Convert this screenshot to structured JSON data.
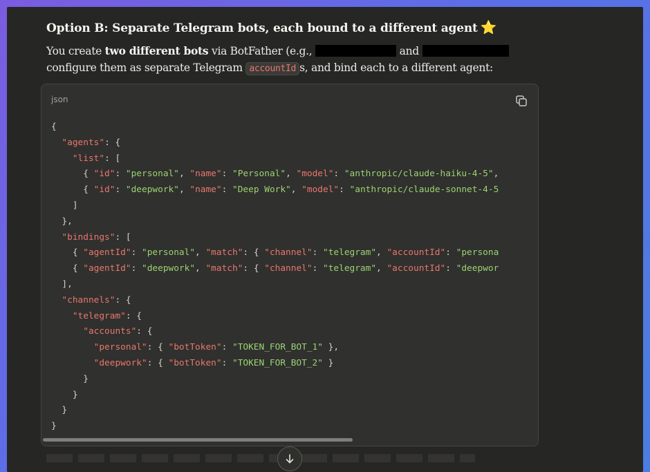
{
  "heading": {
    "title": "Option B: Separate Telegram bots, each bound to a different agent",
    "emoji": "⭐"
  },
  "paragraph": {
    "part1": "You create ",
    "bold": "two different bots",
    "part2": " via BotFather (e.g., ",
    "part3": " and ",
    "line2_start": "configure them as separate Telegram ",
    "inline_code": "accountId",
    "part4": "s, and bind each to a different agent:"
  },
  "code_block": {
    "language": "json",
    "copy_icon": "copy-icon",
    "lines": [
      [
        [
          "p",
          "{"
        ]
      ],
      [
        [
          "p",
          "  "
        ],
        [
          "k",
          "\"agents\""
        ],
        [
          "p",
          ": {"
        ]
      ],
      [
        [
          "p",
          "    "
        ],
        [
          "k",
          "\"list\""
        ],
        [
          "p",
          ": ["
        ]
      ],
      [
        [
          "p",
          "      { "
        ],
        [
          "k",
          "\"id\""
        ],
        [
          "p",
          ": "
        ],
        [
          "s",
          "\"personal\""
        ],
        [
          "p",
          ", "
        ],
        [
          "k",
          "\"name\""
        ],
        [
          "p",
          ": "
        ],
        [
          "s",
          "\"Personal\""
        ],
        [
          "p",
          ", "
        ],
        [
          "k",
          "\"model\""
        ],
        [
          "p",
          ": "
        ],
        [
          "s",
          "\"anthropic/claude-haiku-4-5\""
        ],
        [
          "p",
          ","
        ]
      ],
      [
        [
          "p",
          "      { "
        ],
        [
          "k",
          "\"id\""
        ],
        [
          "p",
          ": "
        ],
        [
          "s",
          "\"deepwork\""
        ],
        [
          "p",
          ", "
        ],
        [
          "k",
          "\"name\""
        ],
        [
          "p",
          ": "
        ],
        [
          "s",
          "\"Deep Work\""
        ],
        [
          "p",
          ", "
        ],
        [
          "k",
          "\"model\""
        ],
        [
          "p",
          ": "
        ],
        [
          "s",
          "\"anthropic/claude-sonnet-4-5"
        ]
      ],
      [
        [
          "p",
          "    ]"
        ]
      ],
      [
        [
          "p",
          "  },"
        ]
      ],
      [
        [
          "p",
          "  "
        ],
        [
          "k",
          "\"bindings\""
        ],
        [
          "p",
          ": ["
        ]
      ],
      [
        [
          "p",
          "    { "
        ],
        [
          "k",
          "\"agentId\""
        ],
        [
          "p",
          ": "
        ],
        [
          "s",
          "\"personal\""
        ],
        [
          "p",
          ", "
        ],
        [
          "k",
          "\"match\""
        ],
        [
          "p",
          ": { "
        ],
        [
          "k",
          "\"channel\""
        ],
        [
          "p",
          ": "
        ],
        [
          "s",
          "\"telegram\""
        ],
        [
          "p",
          ", "
        ],
        [
          "k",
          "\"accountId\""
        ],
        [
          "p",
          ": "
        ],
        [
          "s",
          "\"persona"
        ]
      ],
      [
        [
          "p",
          "    { "
        ],
        [
          "k",
          "\"agentId\""
        ],
        [
          "p",
          ": "
        ],
        [
          "s",
          "\"deepwork\""
        ],
        [
          "p",
          ", "
        ],
        [
          "k",
          "\"match\""
        ],
        [
          "p",
          ": { "
        ],
        [
          "k",
          "\"channel\""
        ],
        [
          "p",
          ": "
        ],
        [
          "s",
          "\"telegram\""
        ],
        [
          "p",
          ", "
        ],
        [
          "k",
          "\"accountId\""
        ],
        [
          "p",
          ": "
        ],
        [
          "s",
          "\"deepwor"
        ]
      ],
      [
        [
          "p",
          "  ],"
        ]
      ],
      [
        [
          "p",
          "  "
        ],
        [
          "k",
          "\"channels\""
        ],
        [
          "p",
          ": {"
        ]
      ],
      [
        [
          "p",
          "    "
        ],
        [
          "k",
          "\"telegram\""
        ],
        [
          "p",
          ": {"
        ]
      ],
      [
        [
          "p",
          "      "
        ],
        [
          "k",
          "\"accounts\""
        ],
        [
          "p",
          ": {"
        ]
      ],
      [
        [
          "p",
          "        "
        ],
        [
          "k",
          "\"personal\""
        ],
        [
          "p",
          ": { "
        ],
        [
          "k",
          "\"botToken\""
        ],
        [
          "p",
          ": "
        ],
        [
          "s",
          "\"TOKEN_FOR_BOT_1\""
        ],
        [
          "p",
          " },"
        ]
      ],
      [
        [
          "p",
          "        "
        ],
        [
          "k",
          "\"deepwork\""
        ],
        [
          "p",
          ": { "
        ],
        [
          "k",
          "\"botToken\""
        ],
        [
          "p",
          ": "
        ],
        [
          "s",
          "\"TOKEN_FOR_BOT_2\""
        ],
        [
          "p",
          " }"
        ]
      ],
      [
        [
          "p",
          "      }"
        ]
      ],
      [
        [
          "p",
          "    }"
        ]
      ],
      [
        [
          "p",
          "  }"
        ]
      ],
      [
        [
          "p",
          "}"
        ]
      ]
    ]
  },
  "scroll_button": {
    "icon": "arrow-down-icon"
  },
  "colors": {
    "key": "#e8776d",
    "string": "#9bd372",
    "background": "#262624",
    "code_background": "#30302e"
  }
}
